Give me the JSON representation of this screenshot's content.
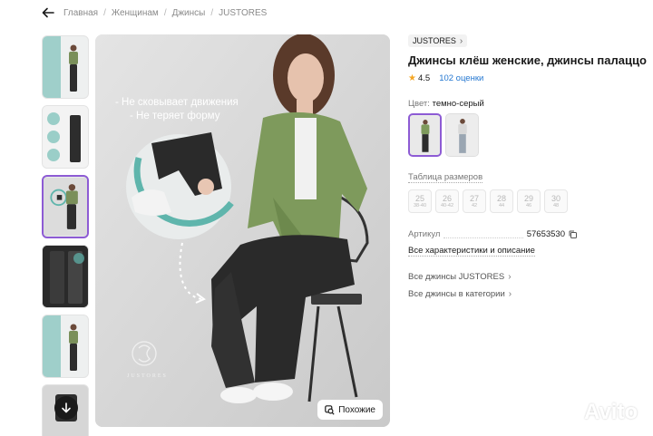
{
  "breadcrumbs": [
    "Главная",
    "Женщинам",
    "Джинсы",
    "JUSTORES"
  ],
  "gallery": {
    "overlay_lines": [
      "- Не сковывает движения",
      "- Не теряет форму"
    ],
    "similar_label": "Похожие",
    "watermark": "JUSTORES",
    "thumbnail_count": 6,
    "active_thumbnail": 3
  },
  "product": {
    "brand": "JUSTORES",
    "title": "Джинсы клёш женские, джинсы палаццо",
    "rating": "4.5",
    "reviews": "102 оценки",
    "color_label": "Цвет:",
    "color_value": "темно-серый",
    "size_table_label": "Таблица размеров",
    "sizes": [
      {
        "size": "25",
        "range": "38-40"
      },
      {
        "size": "26",
        "range": "40-42"
      },
      {
        "size": "27",
        "range": "42"
      },
      {
        "size": "28",
        "range": "44"
      },
      {
        "size": "29",
        "range": "46"
      },
      {
        "size": "30",
        "range": "48"
      }
    ],
    "article_label": "Артикул",
    "article_value": "57653530",
    "all_characteristics": "Все характеристики и описание",
    "all_brand_jeans": "Все джинсы JUSTORES",
    "all_category_jeans": "Все джинсы в категории"
  },
  "watermark_logo": "Avito",
  "colors": {
    "accent": "#8d5bd4",
    "link": "#2477d1",
    "star": "#f5a623",
    "teal": "#5fb5ac"
  }
}
